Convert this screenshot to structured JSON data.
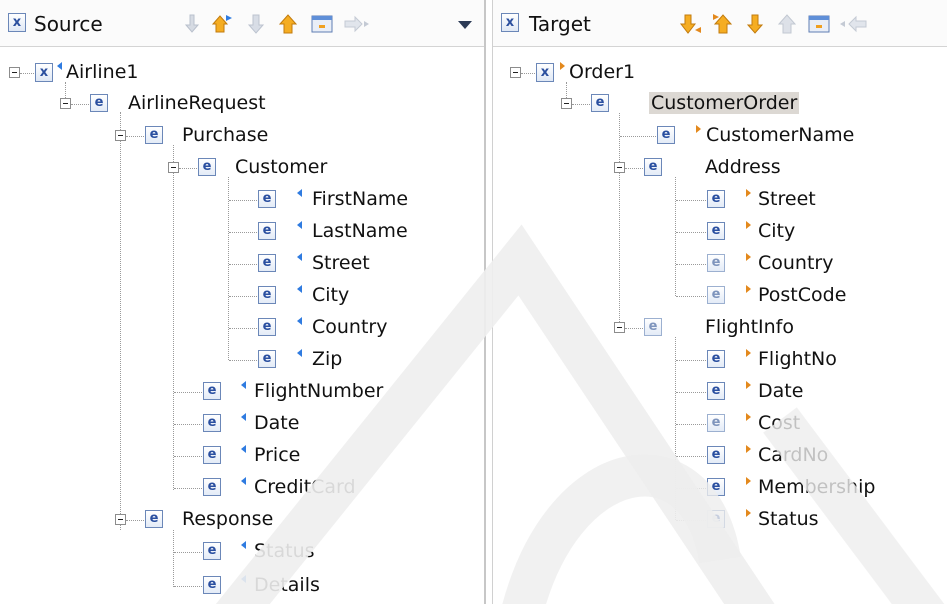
{
  "source": {
    "title": "Source",
    "root": "Airline1",
    "tree": [
      {
        "label": "AirlineRequest"
      },
      {
        "label": "Purchase"
      },
      {
        "label": "Customer"
      },
      {
        "label": "FirstName"
      },
      {
        "label": "LastName"
      },
      {
        "label": "Street"
      },
      {
        "label": "City"
      },
      {
        "label": "Country"
      },
      {
        "label": "Zip"
      },
      {
        "label": "FlightNumber"
      },
      {
        "label": "Date"
      },
      {
        "label": "Price"
      },
      {
        "label": "CreditCard"
      },
      {
        "label": "Response"
      },
      {
        "label": "Status"
      },
      {
        "label": "Details"
      }
    ]
  },
  "target": {
    "title": "Target",
    "root": "Order1",
    "tree": [
      {
        "label": "CustomerOrder"
      },
      {
        "label": "CustomerName"
      },
      {
        "label": "Address"
      },
      {
        "label": "Street"
      },
      {
        "label": "City"
      },
      {
        "label": "Country"
      },
      {
        "label": "PostCode"
      },
      {
        "label": "FlightInfo"
      },
      {
        "label": "FlightNo"
      },
      {
        "label": "Date"
      },
      {
        "label": "Cost"
      },
      {
        "label": "CardNo"
      },
      {
        "label": "Membership"
      },
      {
        "label": "Status"
      }
    ]
  },
  "icons": {
    "element_glyph": "e",
    "schema_glyph": "x"
  },
  "colors": {
    "source_marker": "#2f7be0",
    "target_marker": "#e3891d",
    "toolbar_arrow_orange": "#f0a020",
    "toolbar_arrow_disabled": "#c8cfd8"
  }
}
